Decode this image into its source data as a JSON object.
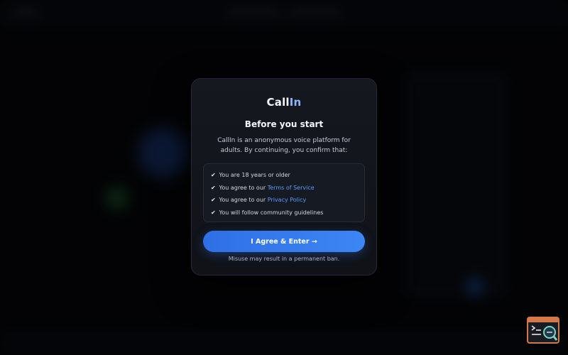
{
  "modal": {
    "brand": {
      "prefix": "Call",
      "accent": "In"
    },
    "title": "Before you start",
    "description": "CallIn is an anonymous voice platform for adults. By continuing, you confirm that:",
    "items": [
      {
        "check": "✔",
        "text": "You are 18 years or older"
      },
      {
        "check": "✔",
        "text": "You agree to our ",
        "link": "Terms of Service"
      },
      {
        "check": "✔",
        "text": "You agree to our ",
        "link": "Privacy Policy"
      },
      {
        "check": "✔",
        "text": "You will follow community guidelines"
      }
    ],
    "agree_label": "I Agree & Enter →",
    "warning": "Misuse may result in a permanent ban."
  },
  "colors": {
    "accent": "#3d86f5",
    "link": "#5b9bff",
    "widget_border": "#d4784a"
  },
  "icons": {
    "check": "check-icon",
    "corner_widget": "terminal-search-icon"
  }
}
